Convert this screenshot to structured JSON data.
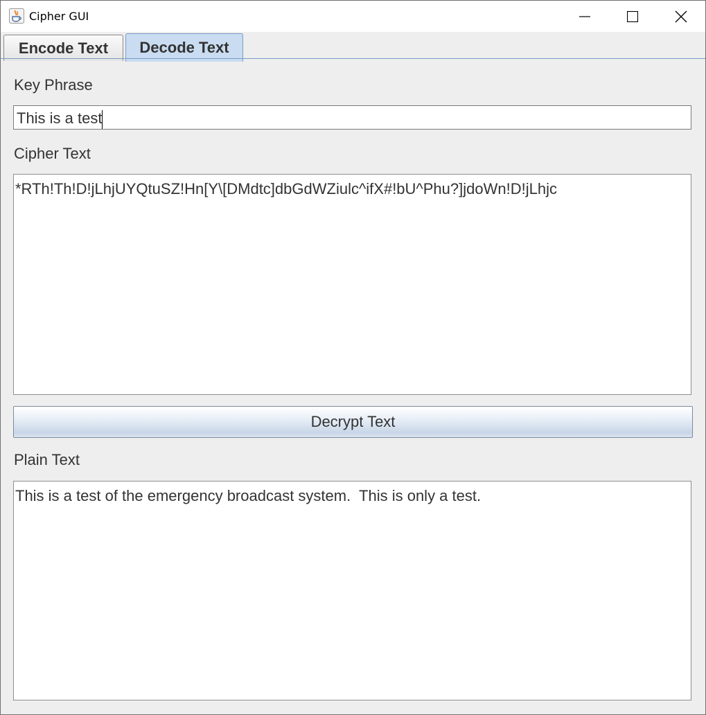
{
  "window": {
    "title": "Cipher GUI",
    "icon": "java-cup-icon"
  },
  "tabs": [
    {
      "label": "Encode Text",
      "selected": false
    },
    {
      "label": "Decode Text",
      "selected": true
    }
  ],
  "key_phrase": {
    "label": "Key Phrase",
    "value": "This is a test"
  },
  "cipher_text": {
    "label": "Cipher Text",
    "value": "*RTh!Th!D!jLhjUYQtuSZ!Hn[Y\\[DMdtc]dbGdWZiulc^ifX#!bU^Phu?]jdoWn!D!jLhjc"
  },
  "decrypt_button": {
    "label": "Decrypt Text"
  },
  "plain_text": {
    "label": "Plain Text",
    "value": "This is a test of the emergency broadcast system.  This is only a test."
  },
  "colors": {
    "active_tab": "#c9dcf1",
    "panel_background": "#eeeeee",
    "text": "#333333"
  }
}
